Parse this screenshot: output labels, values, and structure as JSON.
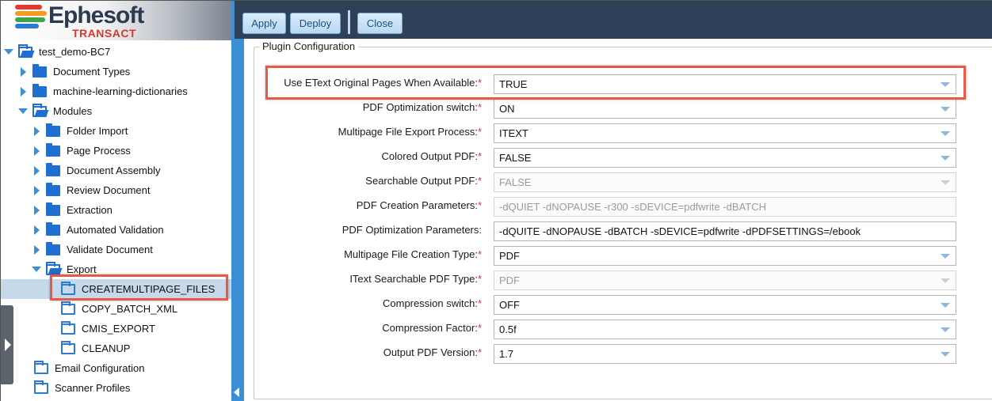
{
  "brand": {
    "name": "Ephesoft",
    "product": "TRANSACT",
    "bar_colors": [
      "#e23b2e",
      "#f39c1f",
      "#3aa84a",
      "#2a7bd4"
    ]
  },
  "toolbar": {
    "apply": "Apply",
    "deploy": "Deploy",
    "close": "Close"
  },
  "tree": {
    "root": "test_demo-BC7",
    "items": [
      {
        "label": "Document Types"
      },
      {
        "label": "machine-learning-dictionaries"
      },
      {
        "label": "Modules"
      },
      {
        "label": "Folder Import"
      },
      {
        "label": "Page Process"
      },
      {
        "label": "Document Assembly"
      },
      {
        "label": "Review Document"
      },
      {
        "label": "Extraction"
      },
      {
        "label": "Automated Validation"
      },
      {
        "label": "Validate Document"
      },
      {
        "label": "Export"
      },
      {
        "label": "CREATEMULTIPAGE_FILES"
      },
      {
        "label": "COPY_BATCH_XML"
      },
      {
        "label": "CMIS_EXPORT"
      },
      {
        "label": "CLEANUP"
      },
      {
        "label": "Email Configuration"
      },
      {
        "label": "Scanner Profiles"
      }
    ]
  },
  "plugin": {
    "legend": "Plugin Configuration",
    "fields": [
      {
        "label": "Use EText Original Pages When Available:",
        "value": "TRUE",
        "required": "*"
      },
      {
        "label": "PDF Optimization switch:",
        "value": "ON",
        "required": "*"
      },
      {
        "label": "Multipage File Export Process:",
        "value": "ITEXT",
        "required": "*"
      },
      {
        "label": "Colored Output PDF:",
        "value": "FALSE",
        "required": "*"
      },
      {
        "label": "Searchable Output PDF:",
        "value": "FALSE",
        "required": "*"
      },
      {
        "label": "PDF Creation Parameters:",
        "value": "-dQUIET -dNOPAUSE -r300 -sDEVICE=pdfwrite -dBATCH",
        "required": "*"
      },
      {
        "label": "PDF Optimization Parameters:",
        "value": "-dQUITE -dNOPAUSE -dBATCH -sDEVICE=pdfwrite -dPDFSETTINGS=/ebook",
        "required": ""
      },
      {
        "label": "Multipage File Creation Type:",
        "value": "PDF",
        "required": "*"
      },
      {
        "label": "IText Searchable PDF Type:",
        "value": "PDF",
        "required": "*"
      },
      {
        "label": "Compression switch:",
        "value": "OFF",
        "required": "*"
      },
      {
        "label": "Compression Factor:",
        "value": "0.5f",
        "required": "*"
      },
      {
        "label": "Output PDF Version:",
        "value": "1.7",
        "required": "*"
      }
    ]
  },
  "colors": {
    "accent": "#3a8fd6",
    "toolbar_bg": "#2f4059",
    "highlight": "#e8594a",
    "required": "#d43a2c"
  }
}
